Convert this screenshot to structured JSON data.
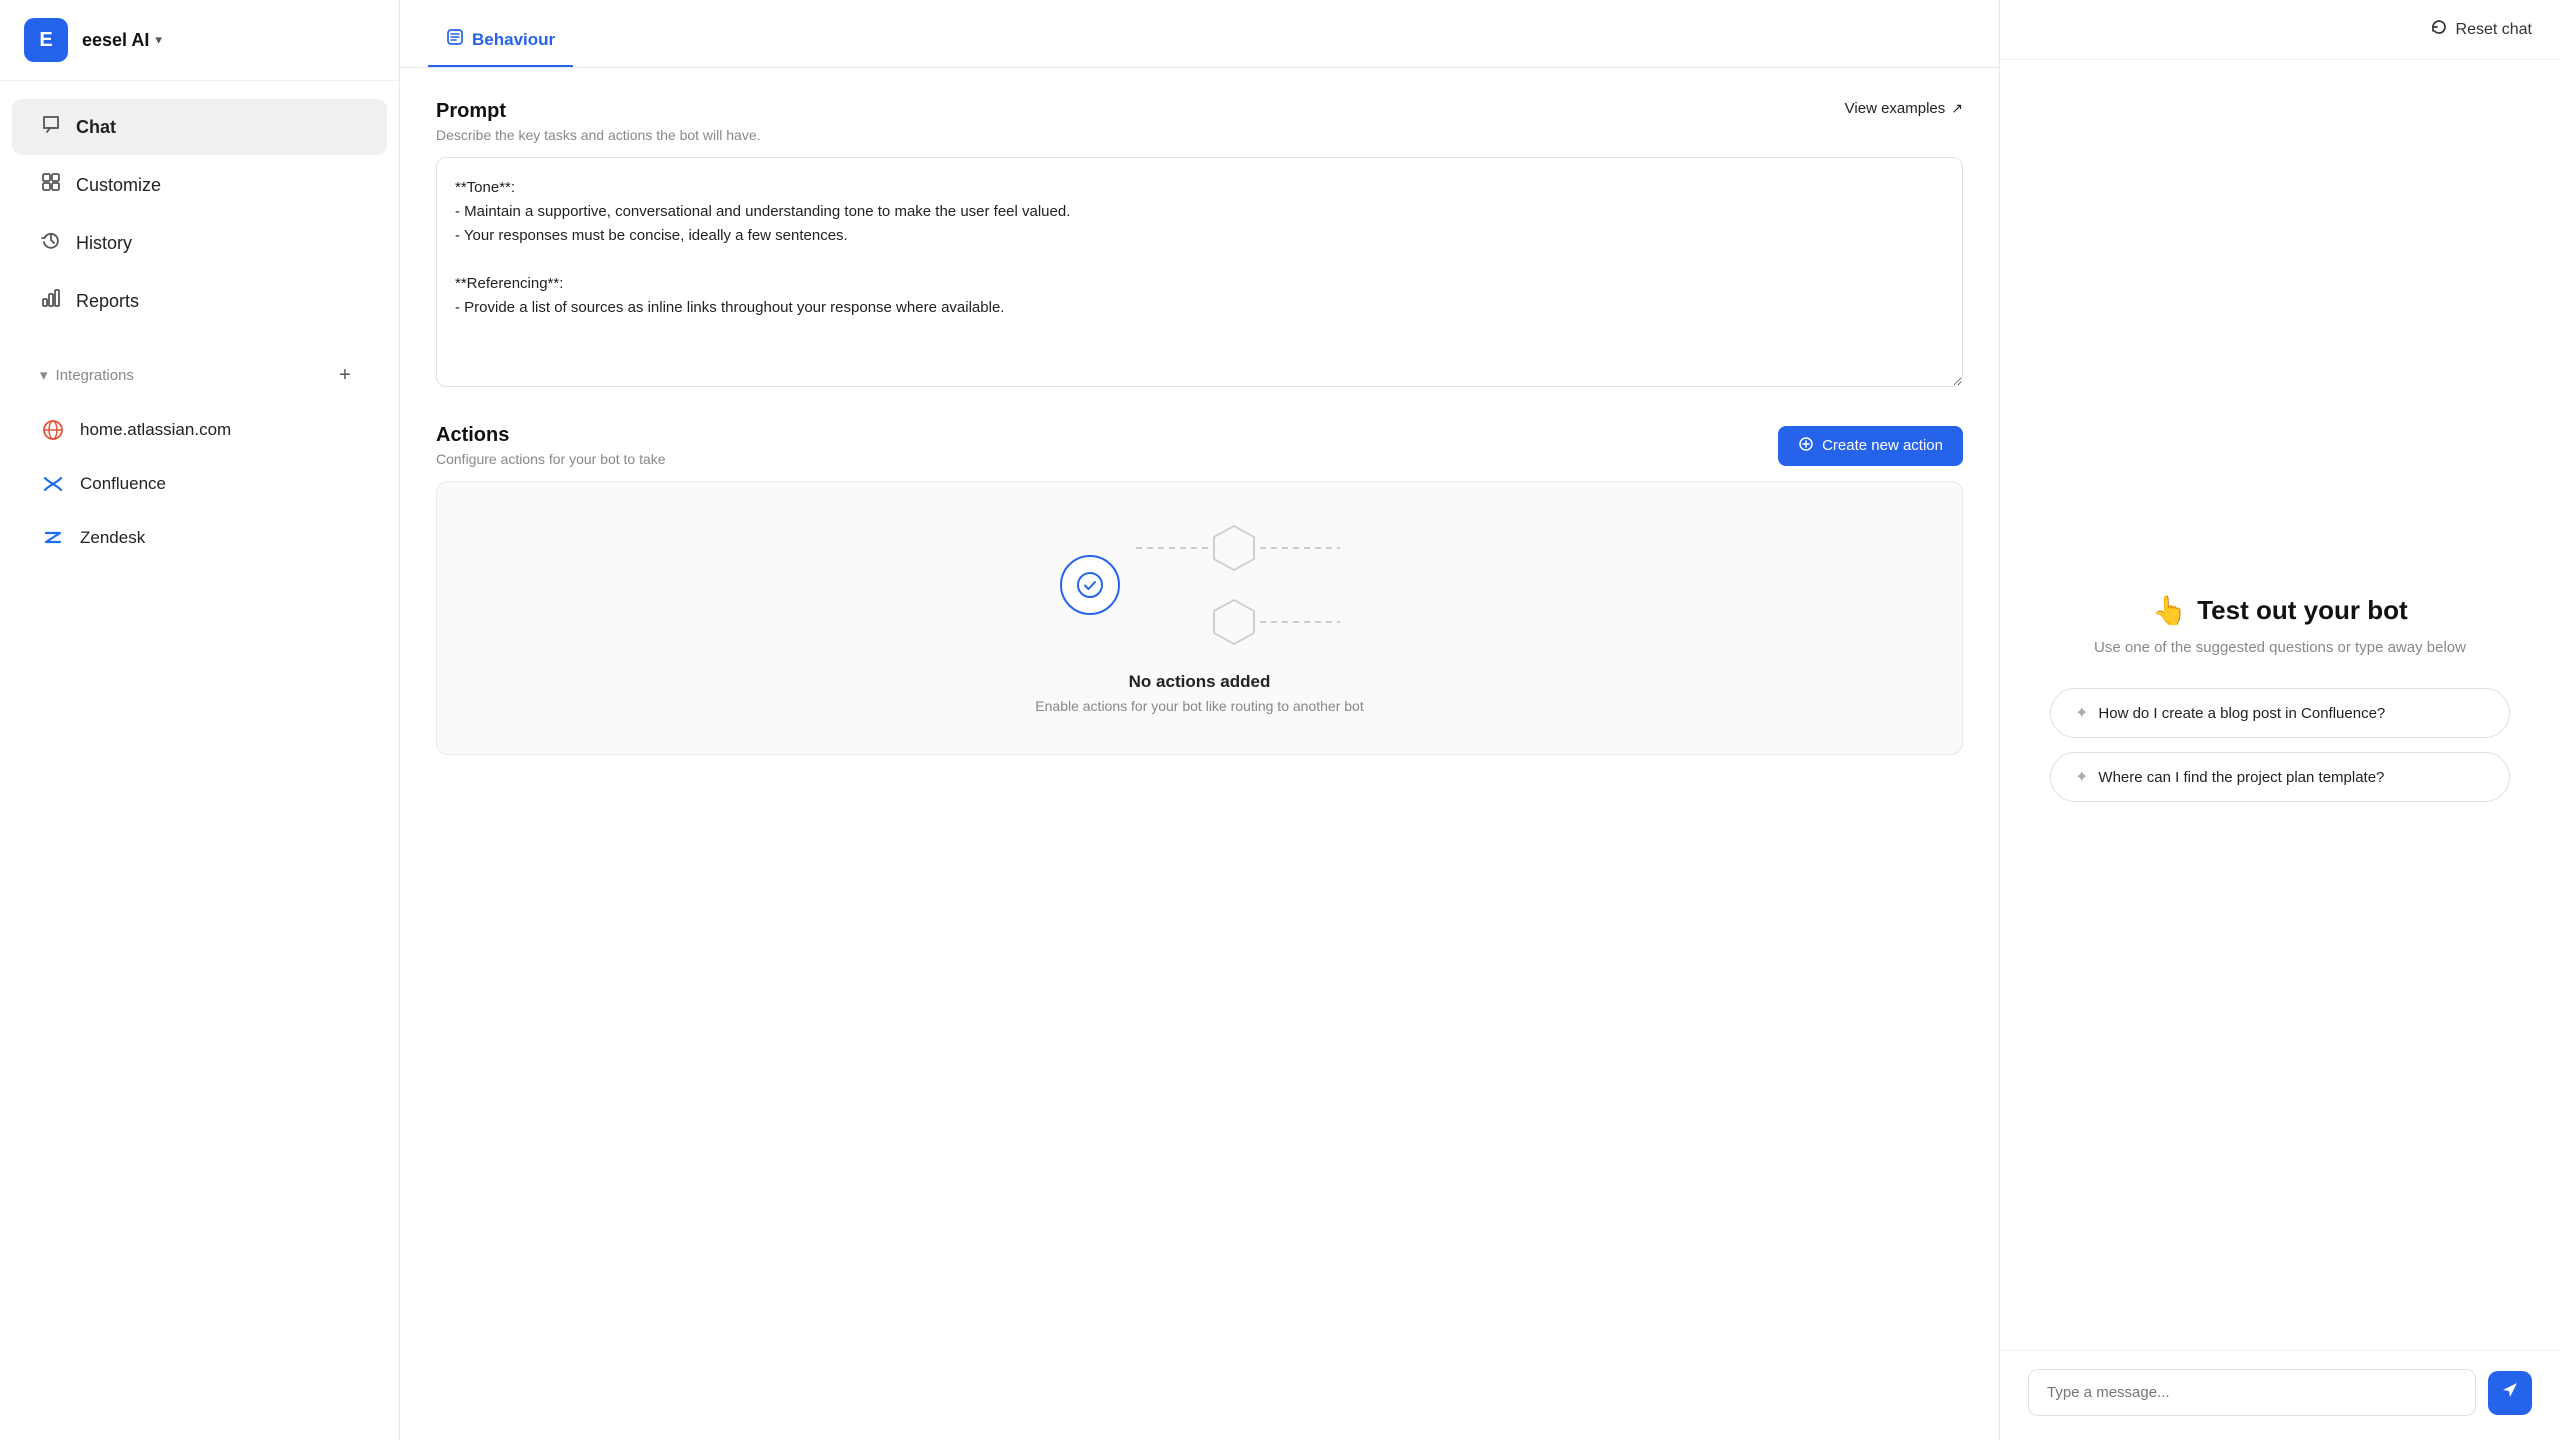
{
  "app": {
    "logo_letter": "E",
    "name": "eesel AI"
  },
  "sidebar": {
    "nav_items": [
      {
        "id": "chat",
        "label": "Chat",
        "icon": "💬",
        "active": true
      },
      {
        "id": "customize",
        "label": "Customize",
        "icon": "⊞",
        "active": false
      },
      {
        "id": "history",
        "label": "History",
        "icon": "↺",
        "active": false
      },
      {
        "id": "reports",
        "label": "Reports",
        "icon": "▦",
        "active": false
      }
    ],
    "integrations_label": "Integrations",
    "integrations": [
      {
        "id": "atlassian",
        "label": "home.atlassian.com",
        "icon": "globe"
      },
      {
        "id": "confluence",
        "label": "Confluence",
        "icon": "confluence"
      },
      {
        "id": "zendesk",
        "label": "Zendesk",
        "icon": "zendesk"
      }
    ]
  },
  "tabs": [
    {
      "id": "behaviour",
      "label": "Behaviour",
      "active": true
    }
  ],
  "prompt_section": {
    "title": "Prompt",
    "description": "Describe the key tasks and actions the bot will have.",
    "view_examples_label": "View examples",
    "textarea_value": "**Tone**:\n- Maintain a supportive, conversational and understanding tone to make the user feel valued.\n- Your responses must be concise, ideally a few sentences.\n\n**Referencing**:\n- Provide a list of sources as inline links throughout your response where available."
  },
  "actions_section": {
    "title": "Actions",
    "description": "Configure actions for your bot to take",
    "create_btn_label": "Create new action",
    "empty_title": "No actions added",
    "empty_desc": "Enable actions for your bot like routing to another bot"
  },
  "right_panel": {
    "reset_btn_label": "Reset chat",
    "test_title": "Test out your bot",
    "test_emoji": "👆",
    "test_desc": "Use one of the suggested questions or type away below",
    "suggestions": [
      {
        "label": "How do I create a blog post in Confluence?"
      },
      {
        "label": "Where can I find the project plan template?"
      }
    ],
    "chat_placeholder": "Type a message..."
  }
}
